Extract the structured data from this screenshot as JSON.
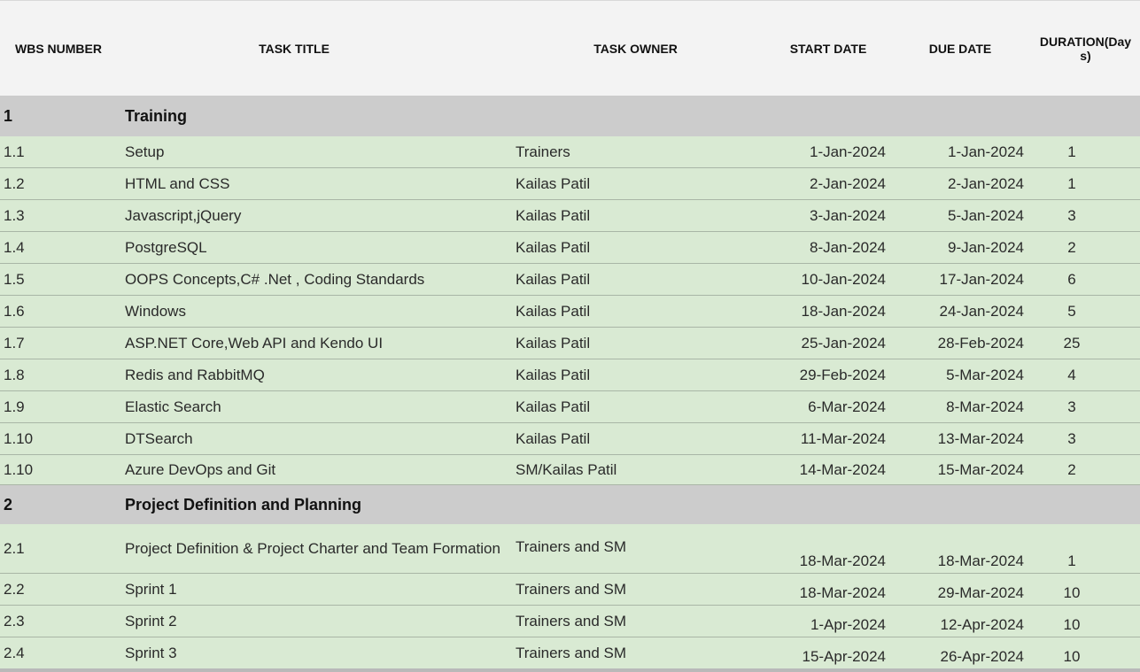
{
  "headers": {
    "wbs": "WBS NUMBER",
    "title": "TASK TITLE",
    "owner": "TASK OWNER",
    "start": "START DATE",
    "due": "DUE DATE",
    "duration_line1": "DURATION(Day",
    "duration_line2": "s)"
  },
  "rows": [
    {
      "kind": "group",
      "wbs": "1",
      "title": "Training"
    },
    {
      "kind": "task",
      "wbs": "1.1",
      "title": "Setup",
      "owner": "Trainers",
      "start": "1-Jan-2024",
      "due": "1-Jan-2024",
      "duration": "1"
    },
    {
      "kind": "task",
      "wbs": "1.2",
      "title": "HTML and CSS",
      "owner": "Kailas Patil",
      "start": "2-Jan-2024",
      "due": "2-Jan-2024",
      "duration": "1"
    },
    {
      "kind": "task",
      "wbs": "1.3",
      "title": "Javascript,jQuery",
      "owner": "Kailas Patil",
      "start": "3-Jan-2024",
      "due": "5-Jan-2024",
      "duration": "3"
    },
    {
      "kind": "task",
      "wbs": "1.4",
      "title": "PostgreSQL",
      "owner": "Kailas Patil",
      "start": "8-Jan-2024",
      "due": "9-Jan-2024",
      "duration": "2"
    },
    {
      "kind": "task",
      "wbs": "1.5",
      "title": "OOPS Concepts,C# .Net , Coding Standards",
      "owner": "Kailas Patil",
      "start": "10-Jan-2024",
      "due": "17-Jan-2024",
      "duration": "6"
    },
    {
      "kind": "task",
      "wbs": "1.6",
      "title": "Windows",
      "owner": "Kailas Patil",
      "start": "18-Jan-2024",
      "due": "24-Jan-2024",
      "duration": "5"
    },
    {
      "kind": "task",
      "wbs": "1.7",
      "title": "ASP.NET Core,Web API and Kendo UI",
      "owner": "Kailas Patil",
      "start": "25-Jan-2024",
      "due": "28-Feb-2024",
      "duration": "25"
    },
    {
      "kind": "task",
      "wbs": "1.8",
      "title": "Redis and RabbitMQ",
      "owner": "Kailas Patil",
      "start": "29-Feb-2024",
      "due": "5-Mar-2024",
      "duration": "4"
    },
    {
      "kind": "task",
      "wbs": "1.9",
      "title": "Elastic Search",
      "owner": "Kailas Patil",
      "start": "6-Mar-2024",
      "due": "8-Mar-2024",
      "duration": "3"
    },
    {
      "kind": "task",
      "wbs": "1.10",
      "title": "DTSearch",
      "owner": "Kailas Patil",
      "start": "11-Mar-2024",
      "due": "13-Mar-2024",
      "duration": "3"
    },
    {
      "kind": "task",
      "wbs": "1.10",
      "title": "Azure DevOps and Git",
      "owner": "SM/Kailas Patil",
      "start": "14-Mar-2024",
      "due": "15-Mar-2024",
      "duration": "2"
    },
    {
      "kind": "group",
      "wbs": "2",
      "title": "Project Definition and Planning"
    },
    {
      "kind": "task",
      "wbs": "2.1",
      "title": "Project Definition & Project Charter and Team Formation",
      "owner": "Trainers and SM",
      "start": "18-Mar-2024",
      "due": "18-Mar-2024",
      "duration": "1"
    },
    {
      "kind": "task",
      "wbs": "2.2",
      "title": "Sprint 1",
      "owner": "Trainers and SM",
      "start": "18-Mar-2024",
      "due": "29-Mar-2024",
      "duration": "10"
    },
    {
      "kind": "task",
      "wbs": "2.3",
      "title": "Sprint 2",
      "owner": "Trainers and SM",
      "start": "1-Apr-2024",
      "due": "12-Apr-2024",
      "duration": "10"
    },
    {
      "kind": "task",
      "wbs": "2.4",
      "title": "Sprint 3",
      "owner": "Trainers and SM",
      "start": "15-Apr-2024",
      "due": "26-Apr-2024",
      "duration": "10"
    }
  ]
}
